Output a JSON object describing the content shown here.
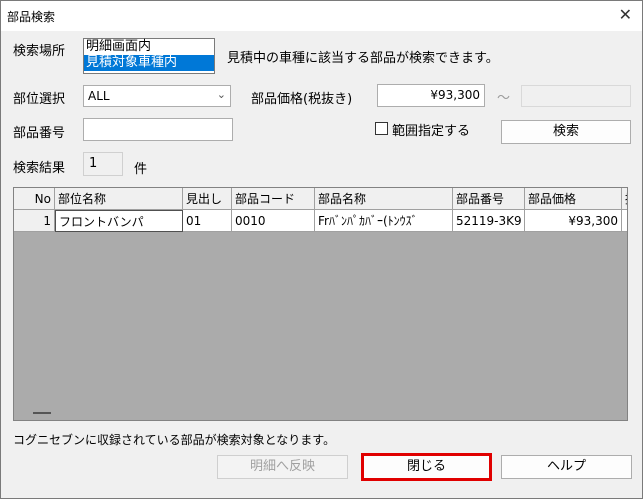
{
  "window": {
    "title": "部品検索",
    "close_glyph": "✕"
  },
  "search_location": {
    "label": "検索場所",
    "options": [
      {
        "label": "明細画面内",
        "selected": false
      },
      {
        "label": "見積対象車種内",
        "selected": true
      }
    ],
    "description": "見積中の車種に該当する部品が検索できます。"
  },
  "part_position": {
    "label": "部位選択",
    "value": "ALL"
  },
  "price": {
    "label": "部品価格(税抜き)",
    "from": "¥93,300",
    "tilde": "～",
    "to": ""
  },
  "part_number": {
    "label": "部品番号",
    "value": ""
  },
  "range": {
    "label": "範囲指定する",
    "checked": false
  },
  "search_button": {
    "label": "検索"
  },
  "result": {
    "label": "検索結果",
    "count": "1",
    "unit": "件"
  },
  "table": {
    "columns": [
      "No",
      "部位名称",
      "見出し",
      "部品コード",
      "部品名称",
      "部品番号",
      "部品価格",
      "摘"
    ],
    "rows": [
      [
        "1",
        "フロントバンパ",
        "01",
        "0010",
        "Frﾊﾞﾝﾊﾟｶﾊﾞｰ(ﾄﾝｳｽﾞ",
        "52119-3K9",
        "¥93,300",
        ""
      ]
    ]
  },
  "footer_message": "コグニセブンに収録されている部品が検索対象となります。",
  "buttons": {
    "reflect": "明細へ反映",
    "close": "閉じる",
    "help": "ヘルプ"
  },
  "colors": {
    "selection": "#0078d7",
    "focus_border": "#e00000"
  }
}
